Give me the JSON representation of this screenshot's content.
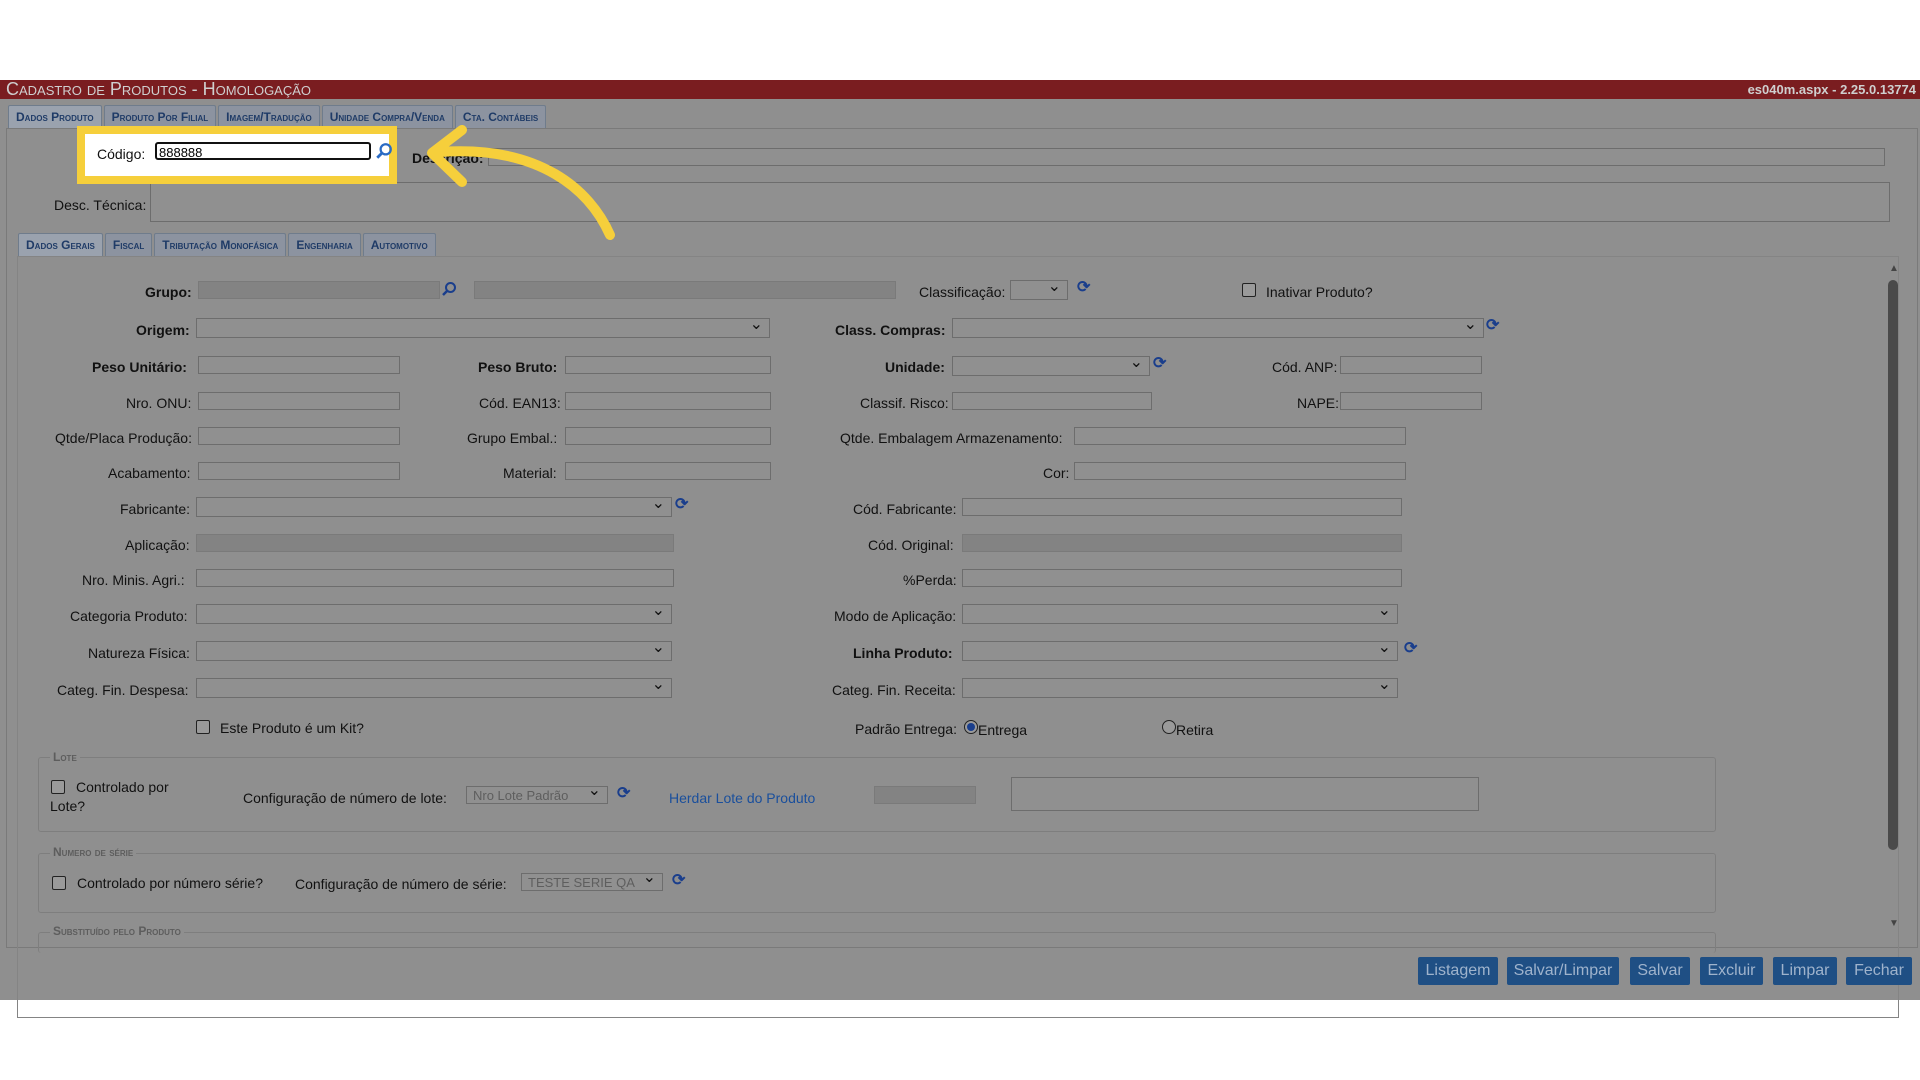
{
  "window": {
    "title": "Cadastro de Produtos  - Homologação",
    "version": "es040m.aspx - 2.25.0.13774"
  },
  "top_tabs": [
    "Dados Produto",
    "Produto Por Filial",
    "Imagem/Tradução",
    "Unidade Compra/Venda",
    "Cta. Contábeis"
  ],
  "header": {
    "codigo_label": "Código:",
    "codigo_value": "888888",
    "descricao_label": "Descrição:",
    "desc_tecnica_label": "Desc. Técnica:"
  },
  "sub_tabs": [
    "Dados Gerais",
    "Fiscal",
    "Tributação Monofásica",
    "Engenharia",
    "Automotivo"
  ],
  "form": {
    "grupo": "Grupo:",
    "classificacao": "Classificação:",
    "inativar": "Inativar Produto?",
    "origem": "Origem:",
    "class_compras": "Class. Compras:",
    "peso_unitario": "Peso Unitário:",
    "peso_bruto": "Peso Bruto:",
    "unidade": "Unidade:",
    "cod_anp": "Cód. ANP:",
    "nro_onu": "Nro. ONU:",
    "cod_ean13": "Cód. EAN13:",
    "classif_risco": "Classif. Risco:",
    "nape": "NAPE:",
    "qtde_placa": "Qtde/Placa Produção:",
    "grupo_embal": "Grupo Embal.:",
    "qtde_embalagem": "Qtde. Embalagem Armazenamento:",
    "acabamento": "Acabamento:",
    "material": "Material:",
    "cor": "Cor:",
    "fabricante": "Fabricante:",
    "cod_fabricante": "Cód. Fabricante:",
    "aplicacao": "Aplicação:",
    "cod_original": "Cód. Original:",
    "nro_minis": "Nro. Minis. Agri.:",
    "perda": "%Perda:",
    "categoria_produto": "Categoria Produto:",
    "modo_aplicacao": "Modo de Aplicação:",
    "natureza_fisica": "Natureza Física:",
    "linha_produto": "Linha Produto:",
    "categ_despesa": "Categ. Fin. Despesa:",
    "categ_receita": "Categ. Fin. Receita:",
    "kit": "Este Produto é um Kit?",
    "padrao_entrega": "Padrão Entrega:",
    "entrega": "Entrega",
    "retira": "Retira"
  },
  "lote": {
    "legend": "Lote",
    "controlado_1": "Controlado por",
    "controlado_2": "Lote?",
    "config_label": "Configuração de número de lote:",
    "config_value": "Nro Lote Padrão",
    "herdar": "Herdar Lote do Produto"
  },
  "serie": {
    "legend": "Numero de série",
    "controlado": "Controlado por número série?",
    "config_label": "Configuração de número de série:",
    "config_value": "TESTE SERIE QA"
  },
  "substituido": {
    "legend": "Substituído pelo Produto"
  },
  "buttons": [
    "Listagem",
    "Salvar/Limpar",
    "Salvar",
    "Excluir",
    "Limpar",
    "Fechar"
  ],
  "colors": {
    "highlight": "#f6cf3b",
    "titlebar": "#7a1d20",
    "button": "#1f4f84",
    "link": "#1a4f9c"
  }
}
